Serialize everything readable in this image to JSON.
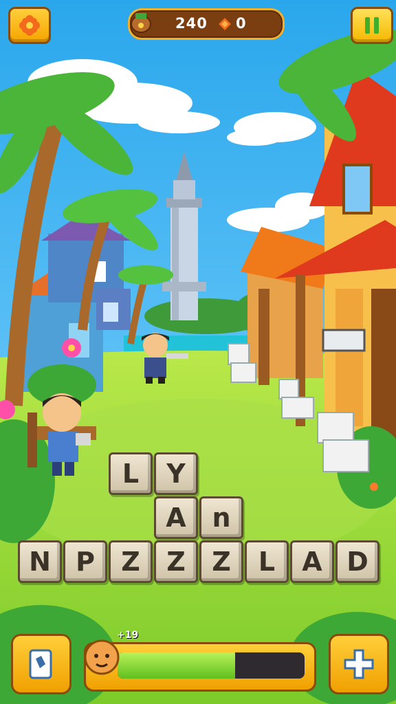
{
  "hud": {
    "score": "240",
    "gems": "0",
    "settings_icon": "flower-icon",
    "pause_icon": "pause-icon",
    "coin_icon": "coin-bag-icon",
    "gem_icon": "gem-icon"
  },
  "board": {
    "rows": [
      [
        "L",
        "Y"
      ],
      [
        "A",
        "n"
      ],
      [
        "N",
        "P",
        "Z",
        "Z",
        "Z",
        "L",
        "A",
        "D"
      ]
    ]
  },
  "footer": {
    "hint_icon": "hint-card-icon",
    "add_icon": "plus-icon",
    "progress_label": "+19",
    "progress_fraction": 0.63,
    "avatar_icon": "avatar-face-icon"
  },
  "colors": {
    "sky": "#3fb7f0",
    "grass": "#8fd63a",
    "accent": "#f5a400",
    "progress": "#7fd62a"
  }
}
